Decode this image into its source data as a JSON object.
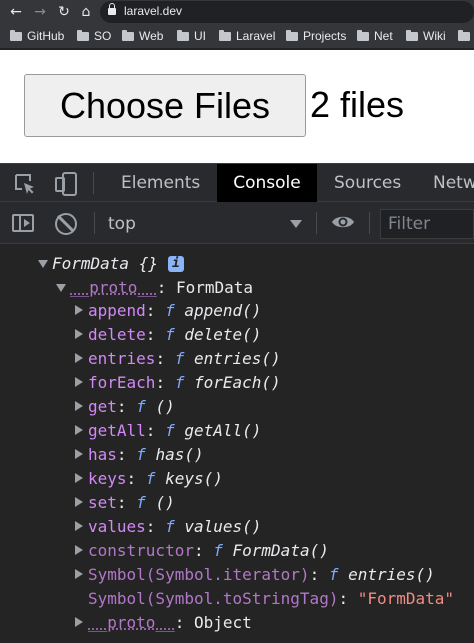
{
  "browser": {
    "url": "laravel.dev",
    "bookmarks": [
      "GitHub",
      "SO",
      "Web",
      "UI",
      "Laravel",
      "Projects",
      "Net",
      "Wiki"
    ]
  },
  "page": {
    "file_button_label": "Choose Files",
    "file_status": "2 files"
  },
  "devtools": {
    "tabs": [
      "Elements",
      "Console",
      "Sources",
      "Netw"
    ],
    "active_tab": "Console",
    "context": "top",
    "filter_placeholder": "Filter"
  },
  "console": {
    "root": "FormData {}",
    "info_badge": "i",
    "proto_label": "__proto__",
    "proto_value": "FormData",
    "entries": [
      {
        "key": "append",
        "f": "f",
        "sig": "append()"
      },
      {
        "key": "delete",
        "f": "f",
        "sig": "delete()"
      },
      {
        "key": "entries",
        "f": "f",
        "sig": "entries()"
      },
      {
        "key": "forEach",
        "f": "f",
        "sig": "forEach()"
      },
      {
        "key": "get",
        "f": "f",
        "sig": "()"
      },
      {
        "key": "getAll",
        "f": "f",
        "sig": "getAll()"
      },
      {
        "key": "has",
        "f": "f",
        "sig": "has()"
      },
      {
        "key": "keys",
        "f": "f",
        "sig": "keys()"
      },
      {
        "key": "set",
        "f": "f",
        "sig": "()"
      },
      {
        "key": "values",
        "f": "f",
        "sig": "values()"
      },
      {
        "key": "constructor",
        "f": "f",
        "sig": "FormData()"
      },
      {
        "key": "Symbol(Symbol.iterator)",
        "f": "f",
        "sig": "entries()"
      }
    ],
    "tostringtag_key": "Symbol(Symbol.toStringTag)",
    "tostringtag_value": "\"FormData\"",
    "inner_proto_label": "__proto__",
    "inner_proto_value": "Object"
  }
}
